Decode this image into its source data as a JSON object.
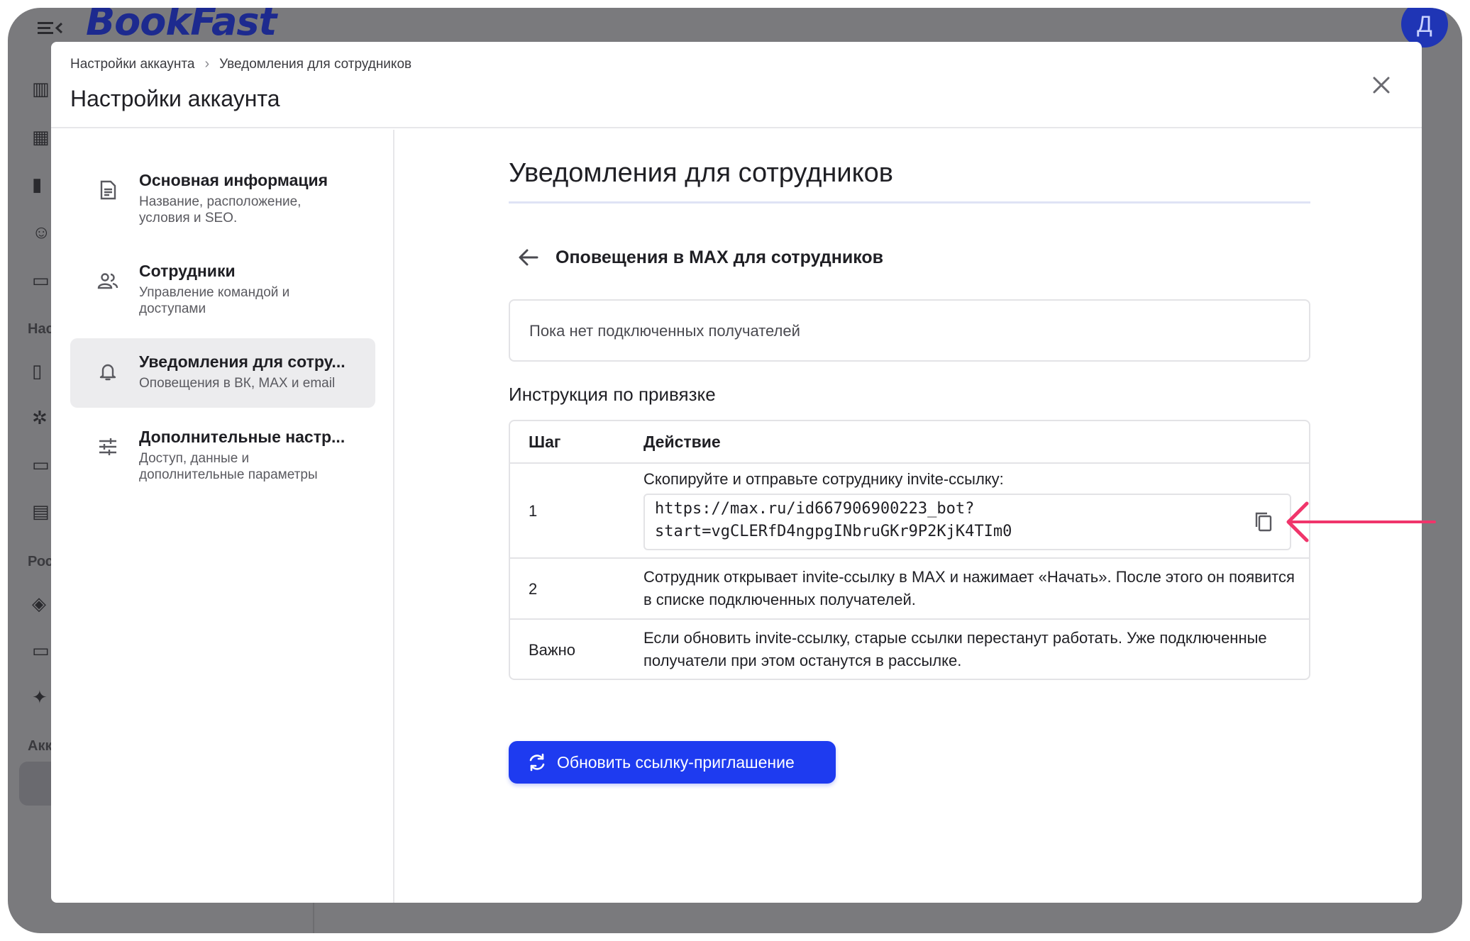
{
  "app": {
    "brand": "BookFast",
    "avatar_letter": "Д"
  },
  "behind_sidebar": {
    "labels": [
      "Нас",
      "Рос",
      "Акк"
    ]
  },
  "modal": {
    "breadcrumb": [
      "Настройки аккаунта",
      "Уведомления для сотрудников"
    ],
    "title": "Настройки аккаунта"
  },
  "sidebar": {
    "items": [
      {
        "title": "Основная информация",
        "subtitle": "Название, расположение, условия и SEO.",
        "icon": "document-icon"
      },
      {
        "title": "Сотрудники",
        "subtitle": "Управление командой и доступами",
        "icon": "people-icon"
      },
      {
        "title": "Уведомления для сотру...",
        "subtitle": "Оповещения в ВК, MAX и email",
        "icon": "bell-icon",
        "active": true
      },
      {
        "title": "Дополнительные настр...",
        "subtitle": "Доступ, данные и дополнительные параметры",
        "icon": "sliders-icon"
      }
    ]
  },
  "content": {
    "heading": "Уведомления для сотрудников",
    "section_title": "Оповещения в MAX для сотрудников",
    "empty_text": "Пока нет подключенных получателей",
    "instructions_title": "Инструкция по привязке",
    "table": {
      "headers": [
        "Шаг",
        "Действие"
      ],
      "rows": [
        {
          "step": "1",
          "action": "Скопируйте и отправьте сотруднику invite-ссылку:",
          "link_line1": "https://max.ru/id667906900223_bot?",
          "link_line2": "start=vgCLERfD4ngpgINbruGKr9P2KjK4TIm0"
        },
        {
          "step": "2",
          "action": "Сотрудник открывает invite-ссылку в MAX и нажимает «Начать». После этого он появится в списке подключенных получателей."
        },
        {
          "step": "Важно",
          "action": "Если обновить invite-ссылку, старые ссылки перестанут работать. Уже подключенные получатели при этом останутся в рассылке."
        }
      ]
    },
    "refresh_button": "Обновить ссылку-приглашение"
  },
  "colors": {
    "accent": "#1e3bf0",
    "annotation": "#f0356b",
    "brand": "#1d2a8f"
  }
}
